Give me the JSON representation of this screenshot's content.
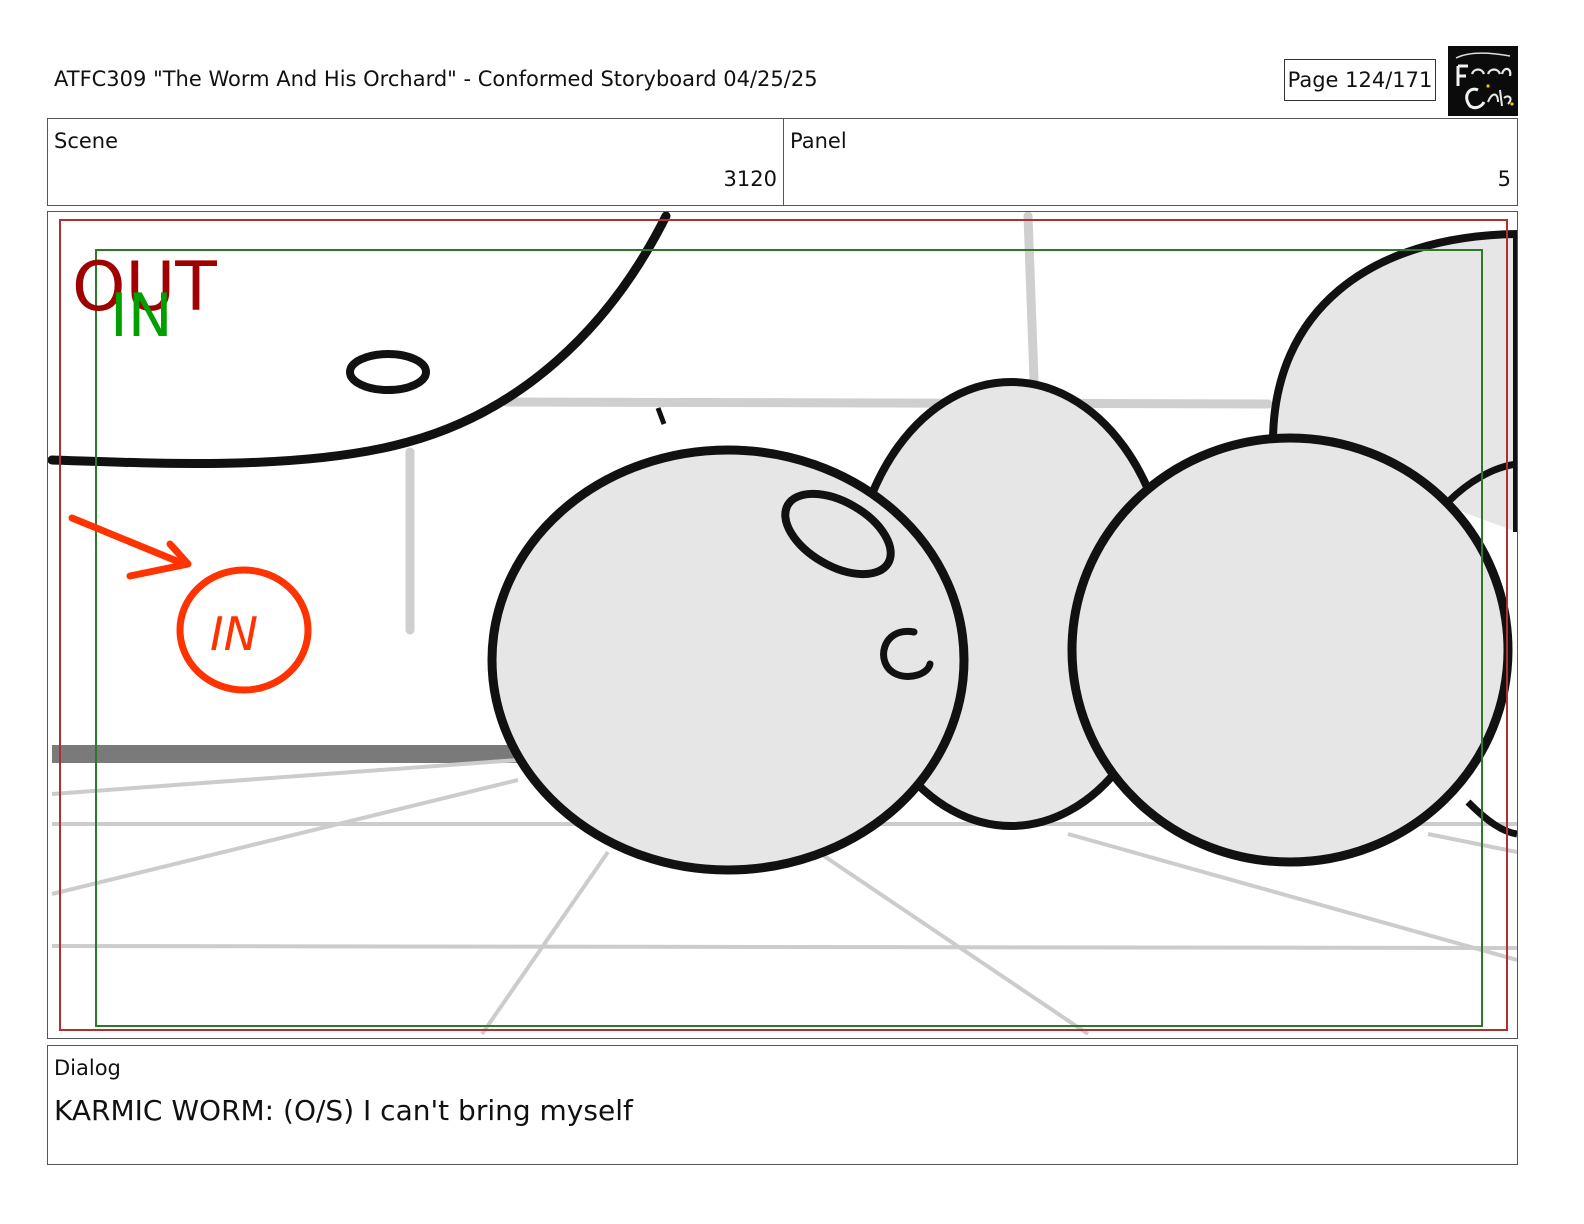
{
  "header": {
    "title": "ATFC309 \"The Worm And His Orchard\" - Conformed Storyboard 04/25/25",
    "page": "Page 124/171",
    "logo_icon": "fionna-and-cake-logo"
  },
  "info": {
    "scene_label": "Scene",
    "scene_value": "3120",
    "panel_label": "Panel",
    "panel_value": "5"
  },
  "frame": {
    "out_label": "OUT",
    "in_label": "IN",
    "out_color": "#a00000",
    "in_color": "#00a000",
    "annotation_color": "#ff3300"
  },
  "dialog": {
    "label": "Dialog",
    "text": "KARMIC WORM: (O/S) I can't bring myself"
  }
}
